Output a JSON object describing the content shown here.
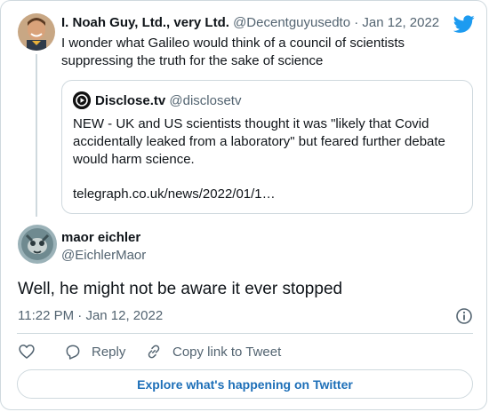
{
  "tweet1": {
    "name": "I. Noah Guy, Ltd., very Ltd.",
    "handle": "@Decentguyusedto",
    "separator": "·",
    "date": "Jan 12, 2022",
    "text": "I wonder what Galileo would think of a council of scientists suppressing the truth for the sake of science"
  },
  "quote": {
    "name": "Disclose.tv",
    "handle": "@disclosetv",
    "text": "NEW - UK and US scientists thought it was \"likely that Covid accidentally leaked from a laboratory\" but feared further debate would harm science.",
    "link": "telegraph.co.uk/news/2022/01/1…"
  },
  "tweet2": {
    "name": "maor eichler",
    "handle": "@EichlerMaor",
    "text": "Well, he might not be aware it ever stopped",
    "time": "11:22 PM",
    "separator": "·",
    "date": "Jan 12, 2022"
  },
  "actions": {
    "reply": "Reply",
    "copy_link": "Copy link to Tweet"
  },
  "explore": "Explore what's happening on Twitter",
  "icons": {
    "logo": "twitter-bird-icon",
    "like": "heart-icon",
    "reply": "speech-bubble-icon",
    "copy": "link-icon",
    "info": "info-icon"
  },
  "colors": {
    "brand": "#1d9bf0",
    "explore_text": "#1d6fb8",
    "muted": "#536471",
    "border": "#cfd9de"
  }
}
